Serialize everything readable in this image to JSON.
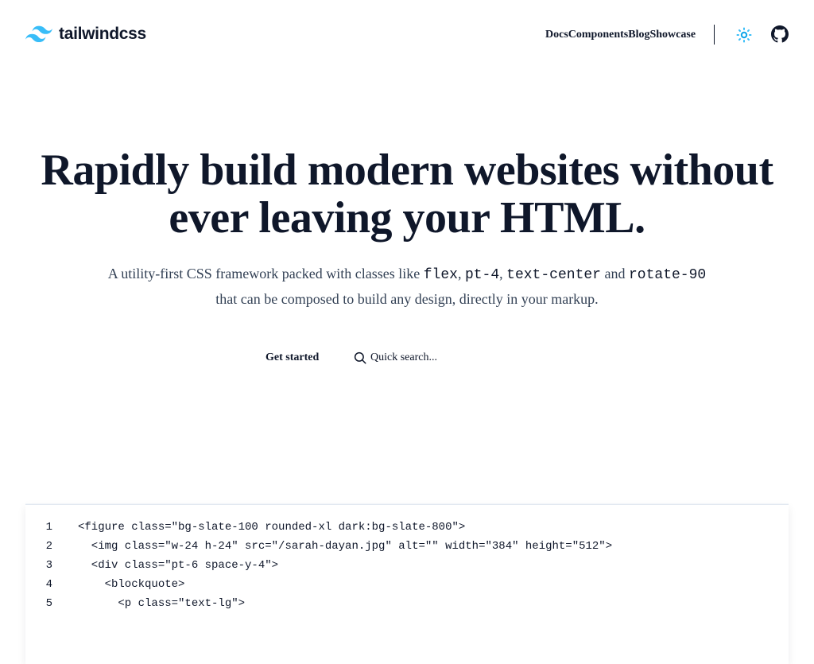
{
  "header": {
    "logo_text": "tailwindcss",
    "brand_color": "#38bdf8",
    "nav": [
      {
        "label": "Docs"
      },
      {
        "label": "Components"
      },
      {
        "label": "Blog"
      },
      {
        "label": "Showcase"
      }
    ],
    "theme_icon": "sun-icon",
    "github_icon": "github-icon"
  },
  "hero": {
    "title_line1": "Rapidly build modern websites without",
    "title_line2": "ever leaving your HTML.",
    "sub_before": "A utility-first CSS framework packed with classes like ",
    "code1": "flex",
    "sep1": ", ",
    "code2": "pt-4",
    "sep2": ", ",
    "code3": "text-center",
    "sep3": " and ",
    "code4": "rotate-90",
    "sub_after": "that can be composed to build any design, directly in your markup."
  },
  "actions": {
    "get_started": "Get started",
    "search_placeholder": "Quick search...",
    "search_icon": "search-icon"
  },
  "code": {
    "lines": [
      {
        "num": "1",
        "text": "<figure class=\"bg-slate-100 rounded-xl dark:bg-slate-800\">"
      },
      {
        "num": "2",
        "text": "  <img class=\"w-24 h-24\" src=\"/sarah-dayan.jpg\" alt=\"\" width=\"384\" height=\"512\">"
      },
      {
        "num": "3",
        "text": "  <div class=\"pt-6 space-y-4\">"
      },
      {
        "num": "4",
        "text": "    <blockquote>"
      },
      {
        "num": "5",
        "text": "      <p class=\"text-lg\">"
      }
    ]
  }
}
